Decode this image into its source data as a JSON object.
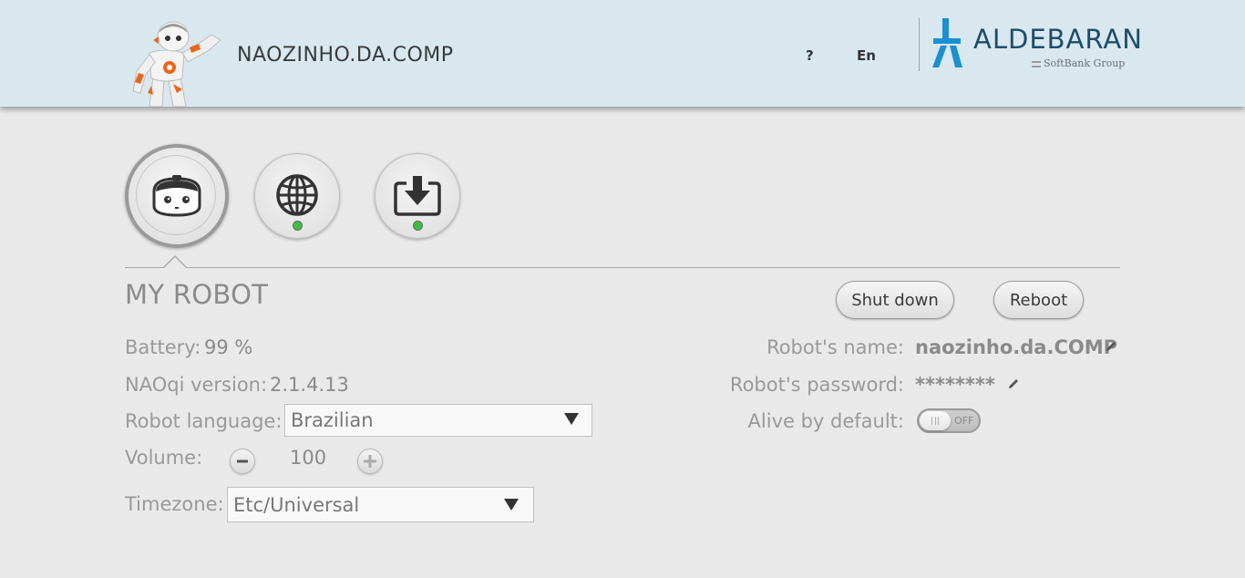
{
  "header": {
    "robot_name": "NAOZINHO.DA.COMP",
    "help_label": "?",
    "language_label": "En",
    "brand": {
      "name": "ALDEBARAN",
      "subtitle": "SoftBank Group",
      "color": "#1a4d6a",
      "logo_color": "#1b8fd0"
    }
  },
  "nav": [
    {
      "name": "robot-tab",
      "icon": "robot-head-icon",
      "selected": true
    },
    {
      "name": "network-tab",
      "icon": "globe-icon",
      "status": "green"
    },
    {
      "name": "update-tab",
      "icon": "download-icon",
      "status": "green"
    }
  ],
  "page": {
    "title": "MY ROBOT",
    "shutdown_label": "Shut down",
    "reboot_label": "Reboot"
  },
  "info": {
    "battery_label": "Battery:",
    "battery_value": "99 %",
    "naoqi_label": "NAOqi version:",
    "naoqi_value": "2.1.4.13",
    "language_label": "Robot language:",
    "language_value": "Brazilian",
    "volume_label": "Volume:",
    "volume_value": "100",
    "timezone_label": "Timezone:",
    "timezone_value": "Etc/Universal"
  },
  "settings": {
    "name_label": "Robot's name:",
    "name_value": "naozinho.da.COMP",
    "password_label": "Robot's password:",
    "password_value": "********",
    "alive_label": "Alive by default:",
    "alive_state": "OFF"
  },
  "colors": {
    "header_bg": "#d9e7ef",
    "page_bg": "#e9e9e9",
    "status_green": "#3cbf3c",
    "robot_orange": "#e8661c"
  }
}
